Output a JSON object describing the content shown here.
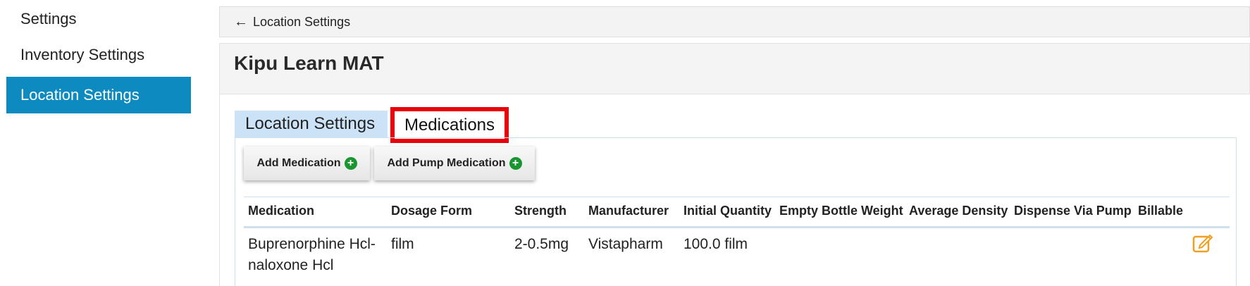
{
  "sidebar": {
    "items": [
      {
        "label": "Settings",
        "active": false
      },
      {
        "label": "Inventory Settings",
        "active": false
      },
      {
        "label": "Location Settings",
        "active": true
      }
    ]
  },
  "back_link": {
    "arrow": "←",
    "label": "Location Settings"
  },
  "page": {
    "title": "Kipu Learn MAT"
  },
  "tabs": [
    {
      "label": "Location Settings",
      "highlighted": false
    },
    {
      "label": "Medications",
      "highlighted": true
    }
  ],
  "buttons": {
    "add_medication": "Add Medication",
    "add_pump_medication": "Add Pump Medication",
    "icon": "plus-circle-icon"
  },
  "table": {
    "columns": [
      "Medication",
      "Dosage Form",
      "Strength",
      "Manufacturer",
      "Initial Quantity",
      "Empty Bottle Weight",
      "Average Density",
      "Dispense Via Pump",
      "Billable"
    ],
    "rows": [
      {
        "medication": "Buprenorphine Hcl-naloxone Hcl",
        "medication_line1": "Buprenorphine Hcl-",
        "medication_line2": "naloxone Hcl",
        "dosage_form": "film",
        "strength": "2-0.5mg",
        "manufacturer": "Vistapharm",
        "initial_quantity": "100.0 film",
        "empty_bottle_weight": "",
        "average_density": "",
        "dispense_via_pump": "",
        "billable": "",
        "action_icon": "edit-icon"
      }
    ]
  },
  "colors": {
    "active_sidebar": "#0d8bc0",
    "tab_background": "#cce2f7",
    "highlight_border": "#e8000b",
    "plus_icon": "#1a9630",
    "edit_icon": "#f0a020"
  }
}
